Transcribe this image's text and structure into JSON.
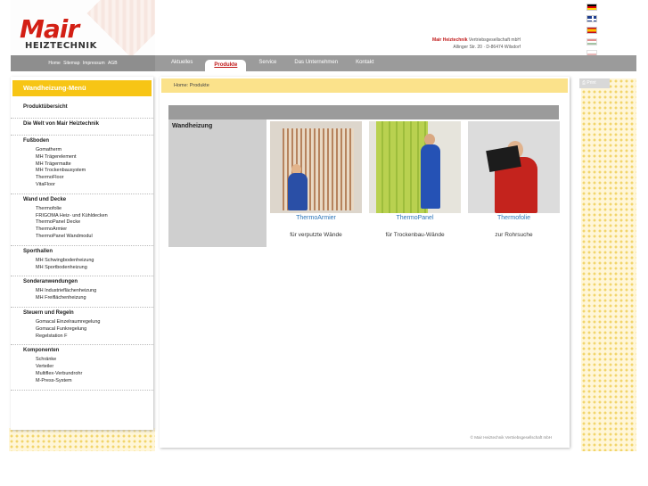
{
  "brand": {
    "logo_main": "Mair",
    "logo_sub": "HEIZTECHNIK",
    "company_name": "Mair Heiztechnik",
    "company_rest": " Vertriebsgesellschaft mbH",
    "address": "Allinger Str. 20 · D-86474 Wilsdorf"
  },
  "languages": [
    "de",
    "gb",
    "es",
    "hu",
    "pl"
  ],
  "toplinks": [
    "Home",
    "Sitemap",
    "Impressum",
    "AGB"
  ],
  "nav": [
    {
      "label": "Aktuelles",
      "active": false
    },
    {
      "label": "Produkte",
      "active": true
    },
    {
      "label": "Service",
      "active": false
    },
    {
      "label": "Das Unternehmen",
      "active": false
    },
    {
      "label": "Kontakt",
      "active": false
    }
  ],
  "sidebar": {
    "title": "Wandheizung-Menü",
    "sections": [
      {
        "head": "Produktübersicht",
        "links": []
      },
      {
        "head": "Die Welt von Mair Heiztechnik",
        "links": []
      },
      {
        "head": "Fußboden",
        "links": [
          "Gomatherm",
          "MH Trägerelement",
          "MH Trägermatte",
          "MH Trockenbausystem",
          "ThermoFloor",
          "VitaFloor"
        ]
      },
      {
        "head": "Wand und Decke",
        "links": [
          "Thermofolie",
          "FRIGOMA Heiz- und Kühldecken",
          "ThermoPanel Decke",
          "ThermoArmier",
          "ThermoPanel Wandmodul"
        ]
      },
      {
        "head": "Sporthallen",
        "links": [
          "MH Schwingbodenheizung",
          "MH Sportbodenheizung"
        ]
      },
      {
        "head": "Sonderanwendungen",
        "links": [
          "MH Industrieflächenheizung",
          "MH Freiflächenheizung"
        ]
      },
      {
        "head": "Steuern und Regeln",
        "links": [
          "Gomacal Einzelraumregelung",
          "Gomacal Funkregelung",
          "Regelstation F"
        ]
      },
      {
        "head": "Komponenten",
        "links": [
          "Schränke",
          "Verteiler",
          "Multiflex-Verbundrohr",
          "M-Press-System"
        ]
      }
    ]
  },
  "breadcrumb": {
    "home": "Home",
    "separator": ":",
    "current": "Produkte"
  },
  "main": {
    "category": "Wandheizung",
    "products": [
      {
        "name": "ThermoArmier",
        "desc": "für verputzte Wände",
        "img": "img1"
      },
      {
        "name": "ThermoPanel",
        "desc": "für Trockenbau-Wände",
        "img": "img2"
      },
      {
        "name": "Thermofolie",
        "desc": "zur Rohrsuche",
        "img": "img3"
      }
    ]
  },
  "footer": "© Mair Heiztechnik Vertriebsgesellschaft mbH",
  "print_label": "Print"
}
